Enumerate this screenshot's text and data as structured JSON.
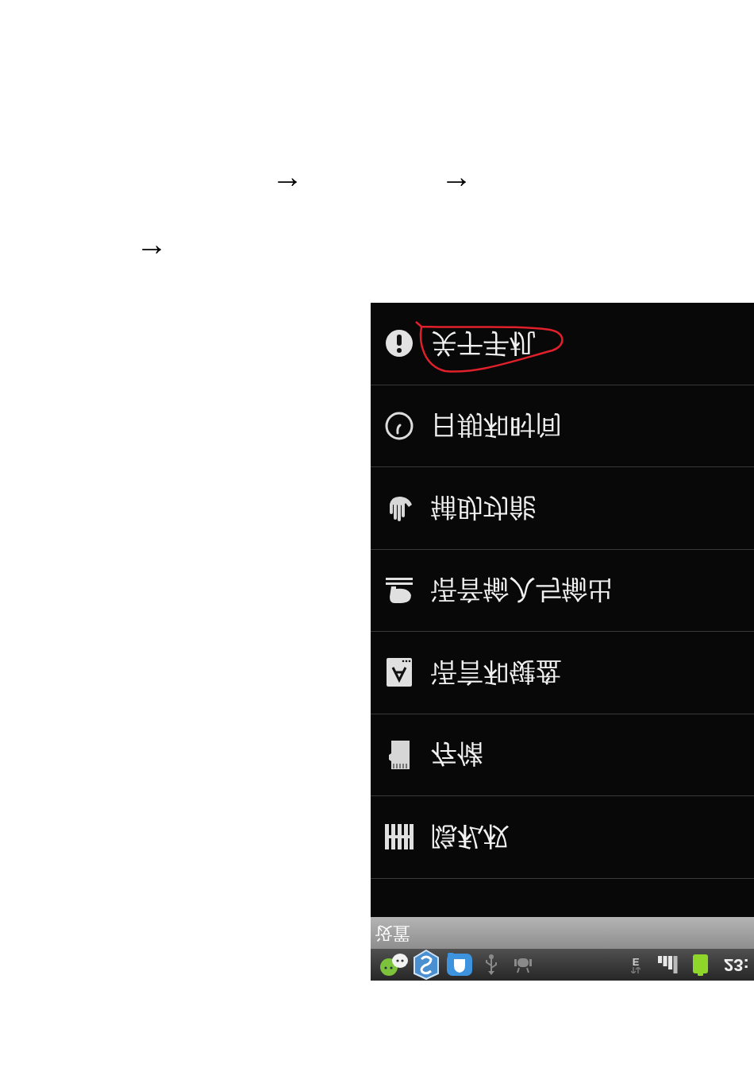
{
  "document": {
    "lines": [
      {
        "arrows": [
          "→",
          "→"
        ]
      },
      {
        "arrows": [
          "→"
        ]
      }
    ]
  },
  "settings_list": {
    "items": [
      {
        "label": "关于手机",
        "circled": true
      },
      {
        "label": "日期和时间",
        "circled": false
      },
      {
        "label": "辅助功能",
        "circled": false
      },
      {
        "label": "语音输入与输出",
        "circled": false
      },
      {
        "label": "语言和键盘",
        "circled": false
      },
      {
        "label": "存储",
        "circled": false
      },
      {
        "label": "隐私权",
        "circled": false
      }
    ]
  },
  "title_bar": {
    "title": "设置"
  },
  "status_bar": {
    "network_type": "E",
    "time": "23:"
  }
}
